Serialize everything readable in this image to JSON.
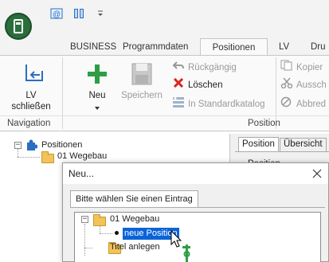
{
  "ribbon_tabs": [
    {
      "label": "BUSINESS"
    },
    {
      "label": "Programmdaten"
    },
    {
      "label": "Positionen"
    },
    {
      "label": "LV"
    },
    {
      "label": "Dru"
    }
  ],
  "ribbon": {
    "navigation": {
      "lv_schliessen_line1": "LV",
      "lv_schliessen_line2": "schließen",
      "group_label": "Navigation"
    },
    "position": {
      "neu": "Neu",
      "speichern": "Speichern",
      "rueckgaengig": "Rückgängig",
      "loeschen": "Löschen",
      "standardkatalog": "In Standardkatalog",
      "kopieren": "Kopier",
      "ausschneiden": "Aussch",
      "abbrechen": "Abbred",
      "group_label": "Position"
    }
  },
  "tree": {
    "root": "Positionen",
    "child": "01 Wegebau"
  },
  "right_panel": {
    "tabs": [
      "Position",
      "Übersicht"
    ],
    "field_label": "Position"
  },
  "dialog": {
    "title": "Neu...",
    "tab_label": "Bitte wählen Sie einen Eintrag",
    "tree": {
      "item1": "01 Wegebau",
      "item1_child": "neue Position",
      "item2": "Titel anlegen"
    }
  },
  "colors": {
    "accent_green": "#2e9e44",
    "orb_green": "#2a6e3b",
    "delete_red": "#d9261c",
    "selection_blue": "#0a64d8",
    "folder_yellow": "#f2c35a"
  }
}
